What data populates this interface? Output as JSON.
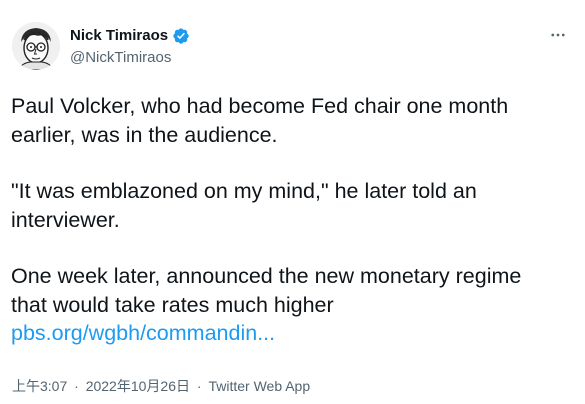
{
  "tweet": {
    "author": {
      "display_name": "Nick Timiraos",
      "handle": "@NickTimiraos",
      "verified": true,
      "avatar_icon": "profile-photo",
      "verified_icon": "verified-badge-icon",
      "more_icon": "more-horizontal-icon"
    },
    "paragraphs": [
      {
        "lines": [
          "Paul Volcker, who had become Fed chair one month",
          "earlier, was in the audience."
        ]
      },
      {
        "lines": [
          "\"It was emblazoned on my mind,\" he later told an",
          "interviewer."
        ]
      },
      {
        "lines": [
          "One week later, announced the new monetary regime",
          "that would take rates much higher"
        ]
      }
    ],
    "link_text": "pbs.org/wgbh/commandin...",
    "time": "上午3:07",
    "date": "2022年10月26日",
    "separator": "·",
    "source": "Twitter Web App"
  },
  "colors": {
    "text": "#0f1419",
    "secondary": "#536471",
    "link": "#1d9bf0",
    "verified": "#1d9bf0"
  }
}
